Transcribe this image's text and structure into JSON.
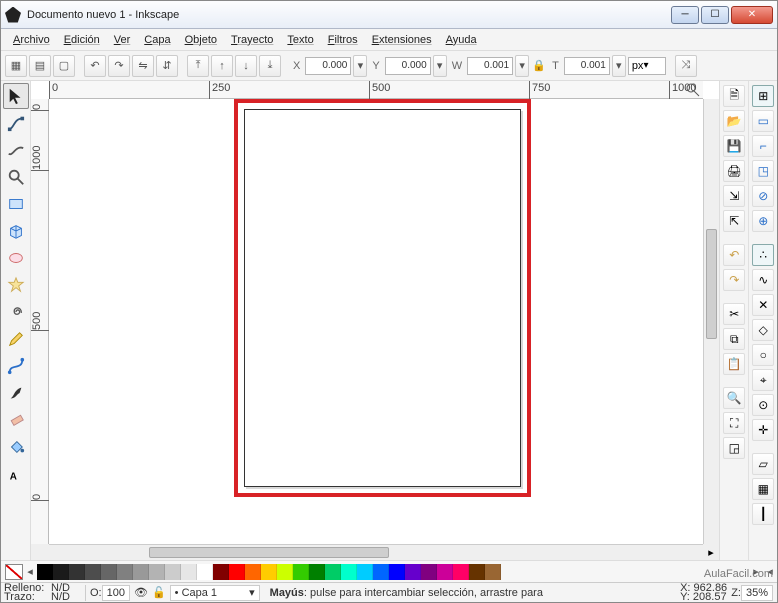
{
  "title": "Documento nuevo 1 - Inkscape",
  "menu": {
    "file": "Archivo",
    "edit": "Edición",
    "view": "Ver",
    "layer": "Capa",
    "object": "Objeto",
    "path": "Trayecto",
    "text": "Texto",
    "filters": "Filtros",
    "extensions": "Extensiones",
    "help": "Ayuda"
  },
  "coords": {
    "x_label": "X",
    "x_value": "0.000",
    "y_label": "Y",
    "y_value": "0.000",
    "w_label": "W",
    "w_value": "0.001",
    "t_label": "T",
    "t_value": "0.001",
    "unit": "px"
  },
  "ruler": {
    "h": [
      "0",
      "250",
      "500",
      "750",
      "1000"
    ],
    "v": [
      "0",
      "1000",
      "500",
      "0"
    ]
  },
  "palette": [
    "#000000",
    "#1a1a1a",
    "#333333",
    "#4d4d4d",
    "#666666",
    "#808080",
    "#999999",
    "#b3b3b3",
    "#cccccc",
    "#e6e6e6",
    "#ffffff",
    "#800000",
    "#ff0000",
    "#ff6600",
    "#ffcc00",
    "#ccff00",
    "#33cc00",
    "#008000",
    "#00cc66",
    "#00ffcc",
    "#00ccff",
    "#0066ff",
    "#0000ff",
    "#6600cc",
    "#800080",
    "#cc0099",
    "#ff0066",
    "#663300",
    "#996633"
  ],
  "status": {
    "fill_label": "Relleno:",
    "stroke_label": "Trazo:",
    "fill_value": "N/D",
    "stroke_value": "N/D",
    "opacity_label": "O:",
    "opacity_value": "100",
    "layer_prefix": "•",
    "layer_name": "Capa 1",
    "hint_bold": "Mayús",
    "hint_rest": ": pulse para intercambiar selección, arrastre para",
    "x_label": "X:",
    "x_value": "962.86",
    "y_label": "Y:",
    "y_value": "208.57",
    "z_label": "Z:",
    "z_value": "35%"
  },
  "watermark": "AulaFacil.com"
}
